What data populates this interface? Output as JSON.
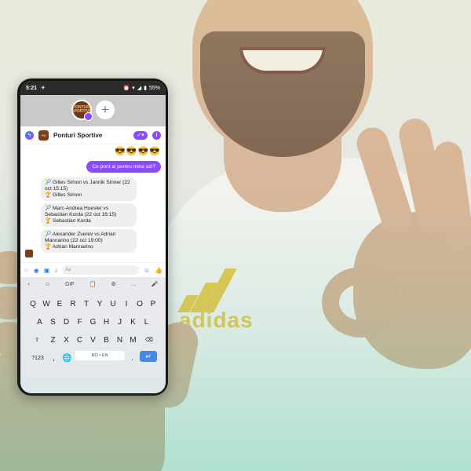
{
  "status_bar": {
    "time": "5:21",
    "battery": "55%"
  },
  "chat_head": {
    "label": "PONTURI SPORTIVE"
  },
  "chat": {
    "title": "Ponturi Sportive",
    "emojis": "😎😎😎😎",
    "outgoing": "Ce pont ai pentru mine azi?",
    "tips": [
      {
        "match": "🎾 Gilles Simon vs Jannik Sinner (22 oct 15:15)",
        "pick": "🏆 Gilles Simon"
      },
      {
        "match": "🎾 Marc-Andrea Huesler vs Sebastian Korda (22 oct 16:15)",
        "pick": "🏆 Sebastian Korda"
      },
      {
        "match": "🎾 Alexander Zverev vs Adrian Mannarino (22 oct 19:00)",
        "pick": "🏆 Adrian Mannarino"
      }
    ]
  },
  "composer": {
    "placeholder": "Aa"
  },
  "keyboard": {
    "toolbar": [
      "‹",
      "☺",
      "GIF",
      "📋",
      "⚙",
      "…",
      "🎤"
    ],
    "row1": [
      "Q",
      "W",
      "E",
      "R",
      "T",
      "Y",
      "U",
      "I",
      "O",
      "P"
    ],
    "row2": [
      "A",
      "S",
      "D",
      "F",
      "G",
      "H",
      "J",
      "K",
      "L"
    ],
    "row3": [
      "Z",
      "X",
      "C",
      "V",
      "B",
      "N",
      "M"
    ],
    "symbols": "?123",
    "comma": ",",
    "space": "RO • EN",
    "period": "."
  },
  "background": {
    "shirt_brand": "adidas"
  },
  "colors": {
    "accent": "#8a4bff",
    "messenger_blue": "#2d7be5",
    "keyboard_bg": "#e8eaed"
  }
}
